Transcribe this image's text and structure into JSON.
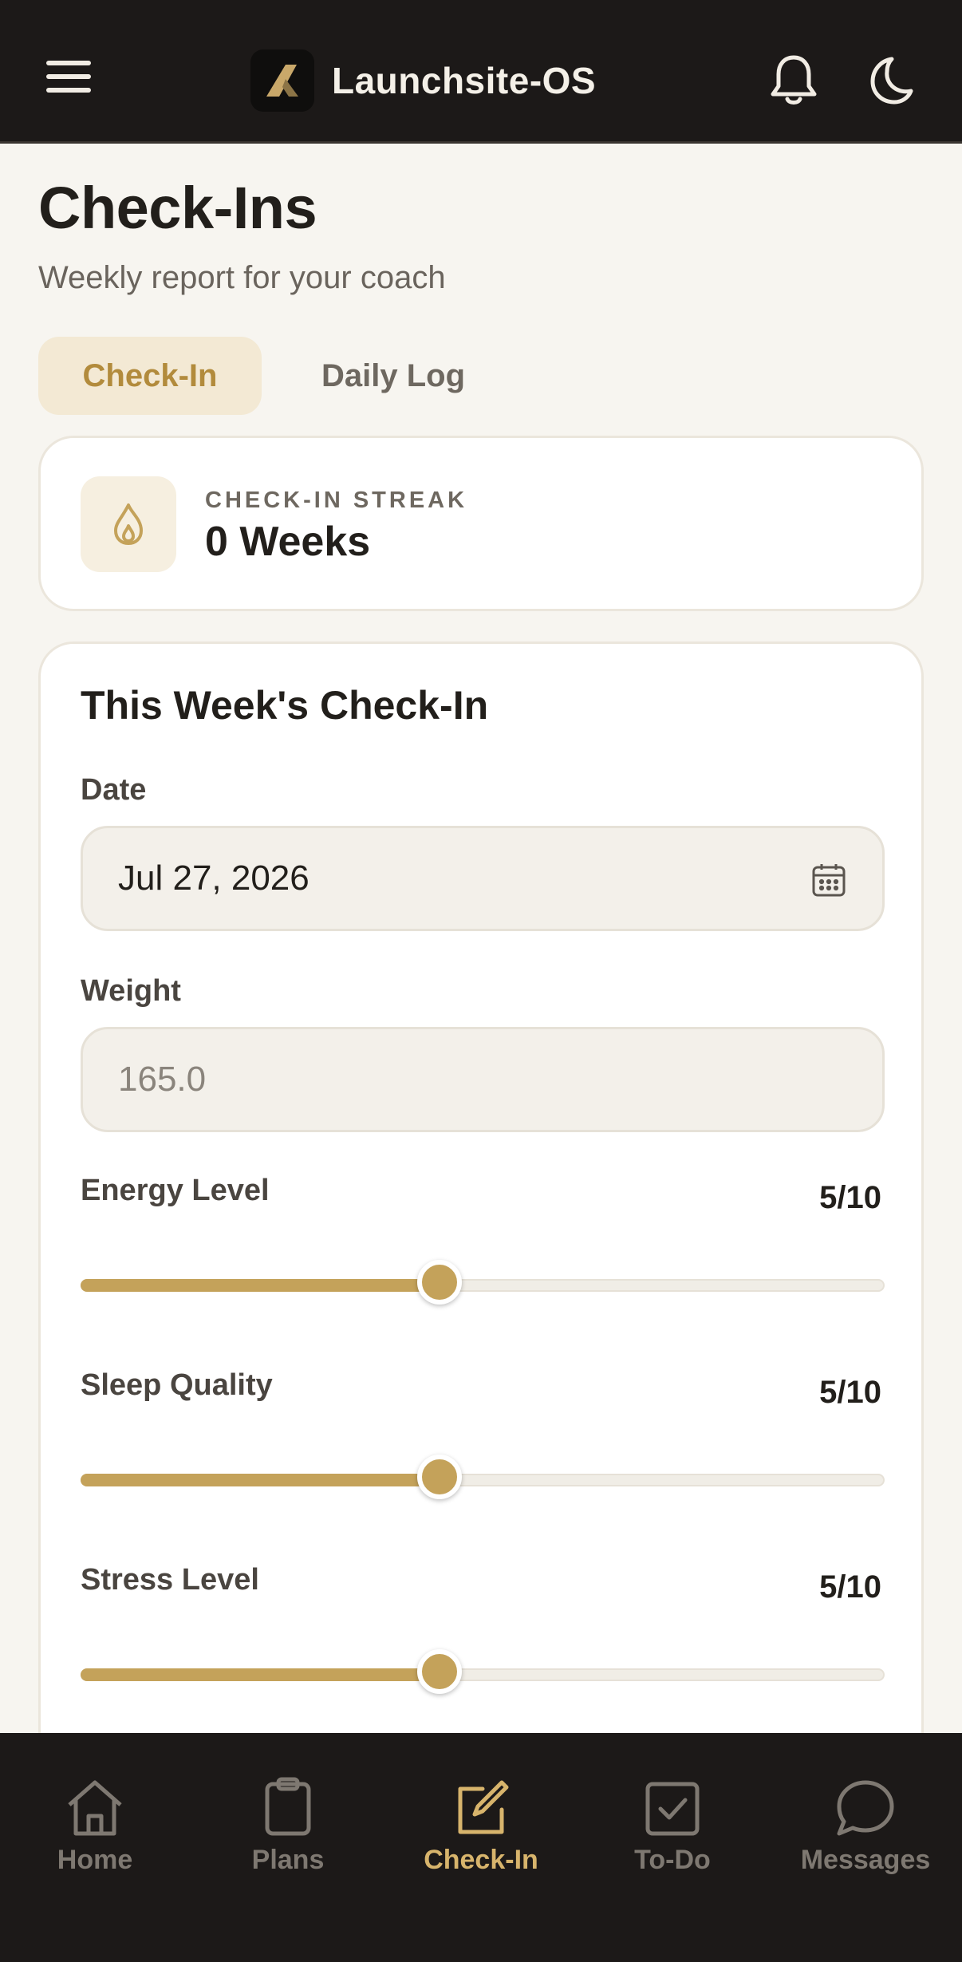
{
  "app": {
    "title": "Launchsite-OS"
  },
  "header": {
    "menu_icon": "hamburger-menu-icon",
    "notifications_icon": "bell-icon",
    "theme_icon": "moon-icon"
  },
  "page": {
    "title": "Check-Ins",
    "subtitle": "Weekly report for your coach"
  },
  "tabs": [
    {
      "label": "Check-In",
      "active": true
    },
    {
      "label": "Daily Log",
      "active": false
    }
  ],
  "streak": {
    "icon": "flame-icon",
    "label": "CHECK-IN STREAK",
    "value": "0 Weeks"
  },
  "form": {
    "title": "This Week's Check-In",
    "date": {
      "label": "Date",
      "value": "Jul 27, 2026",
      "icon": "calendar-icon"
    },
    "weight": {
      "label": "Weight",
      "placeholder": "165.0"
    },
    "sliders": [
      {
        "label": "Energy Level",
        "value_text": "5/10",
        "value": 5,
        "max": 10
      },
      {
        "label": "Sleep Quality",
        "value_text": "5/10",
        "value": 5,
        "max": 10
      },
      {
        "label": "Stress Level",
        "value_text": "5/10",
        "value": 5,
        "max": 10
      }
    ]
  },
  "bottom_nav": [
    {
      "label": "Home",
      "icon": "home-icon",
      "active": false
    },
    {
      "label": "Plans",
      "icon": "clipboard-icon",
      "active": false
    },
    {
      "label": "Check-In",
      "icon": "edit-square-icon",
      "active": true
    },
    {
      "label": "To-Do",
      "icon": "checkbox-icon",
      "active": false
    },
    {
      "label": "Messages",
      "icon": "chat-bubble-icon",
      "active": false
    }
  ],
  "colors": {
    "accent": "#c4a25a",
    "accent_text": "#b28b3c",
    "bar_background": "#1c1918",
    "page_background": "#f7f5f0"
  }
}
